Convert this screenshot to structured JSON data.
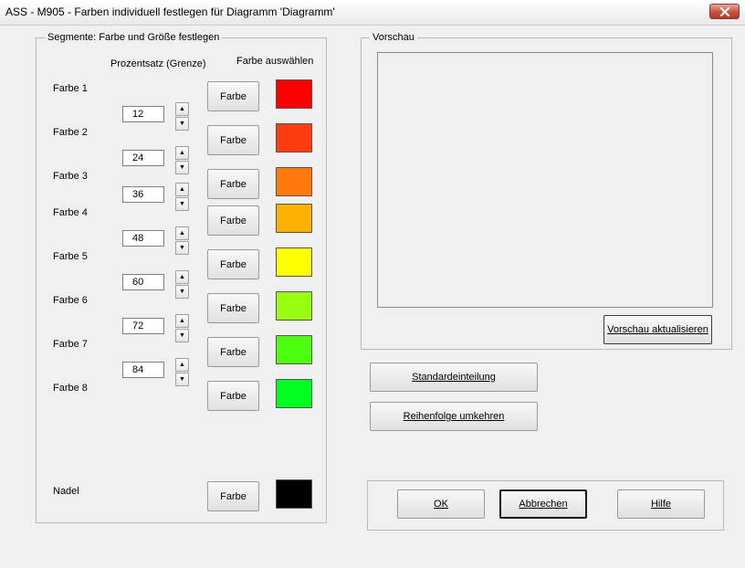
{
  "window": {
    "title": "ASS - M905 - Farben individuell festlegen für Diagramm 'Diagramm'"
  },
  "segments": {
    "legend": "Segmente: Farbe und Größe festlegen",
    "header_percent": "Prozentsatz (Grenze)",
    "header_color": "Farbe auswählen",
    "button_label": "Farbe",
    "colors": [
      {
        "label": "Farbe 1",
        "color": "#ff0000"
      },
      {
        "label": "Farbe 2",
        "color": "#ff3c10"
      },
      {
        "label": "Farbe 3",
        "color": "#ff7a0a"
      },
      {
        "label": "Farbe 4",
        "color": "#ffb100"
      },
      {
        "label": "Farbe 5",
        "color": "#ffff00"
      },
      {
        "label": "Farbe 6",
        "color": "#99ff10"
      },
      {
        "label": "Farbe 7",
        "color": "#4dff0f"
      },
      {
        "label": "Farbe 8",
        "color": "#00ff20"
      }
    ],
    "limits": [
      "12",
      "24",
      "36",
      "48",
      "60",
      "72",
      "84"
    ],
    "needle": {
      "label": "Nadel",
      "color": "#000000"
    }
  },
  "preview": {
    "legend": "Vorschau",
    "refresh_label": "Vorschau aktualisieren"
  },
  "actions": {
    "standard_label": "Standardeinteilung",
    "reverse_label": "Reihenfolge umkehren"
  },
  "footer": {
    "ok_label": "OK",
    "cancel_label": "Abbrechen",
    "help_label": "Hilfe"
  }
}
